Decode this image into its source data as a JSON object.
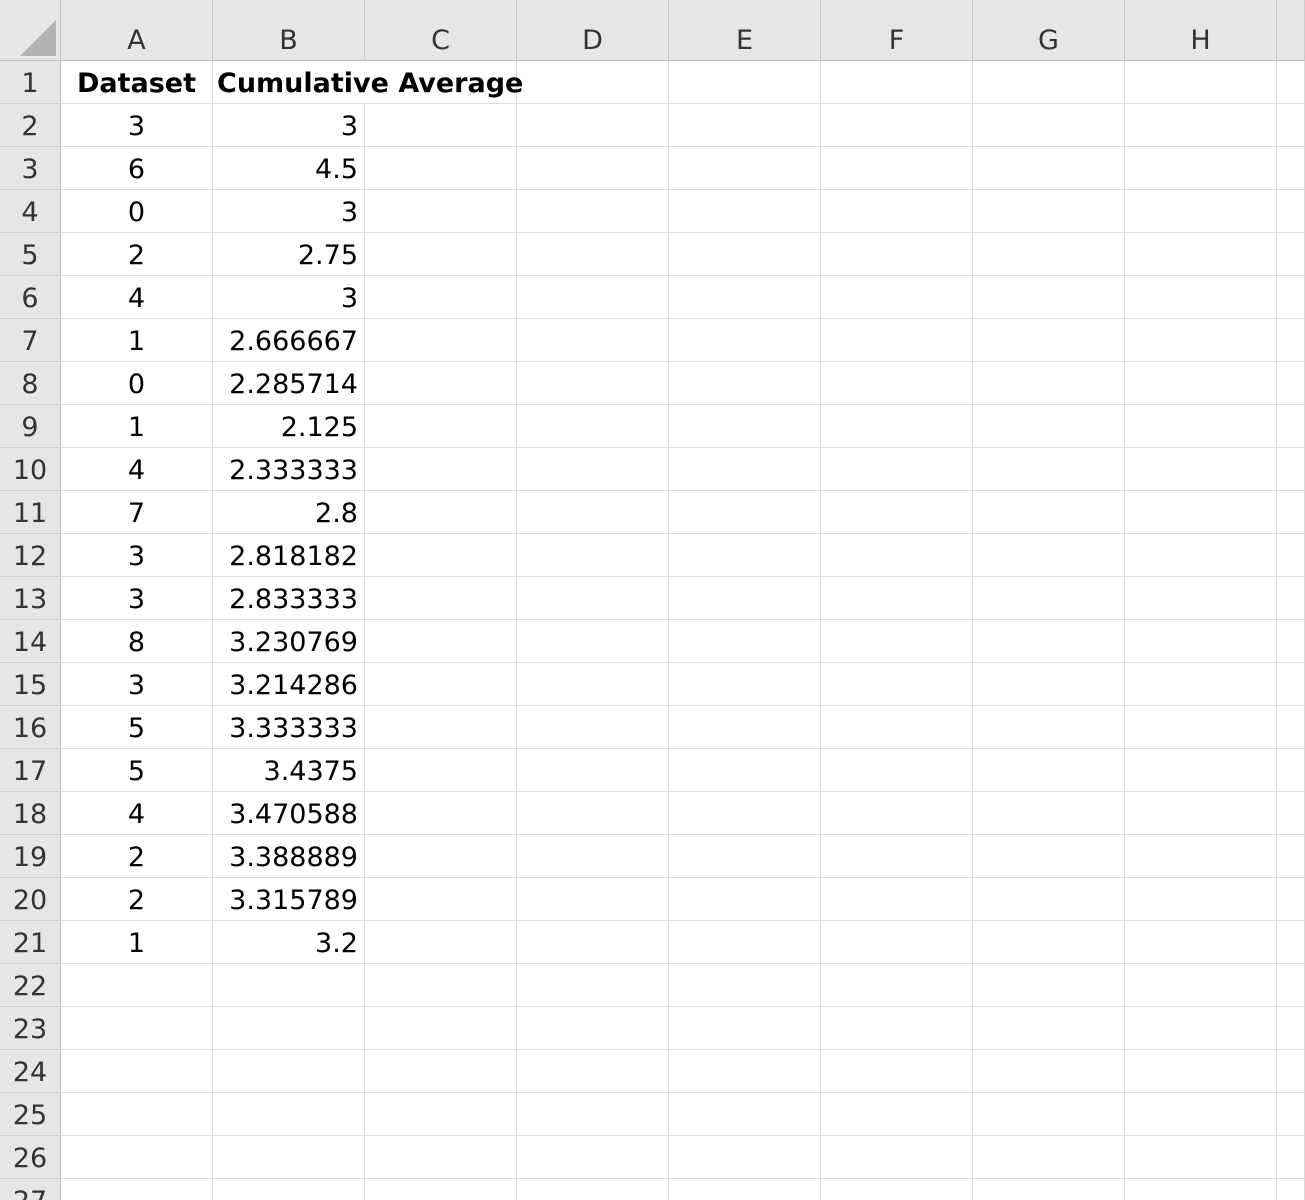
{
  "columns": [
    "A",
    "B",
    "C",
    "D",
    "E",
    "F",
    "G",
    "H"
  ],
  "rows": [
    "1",
    "2",
    "3",
    "4",
    "5",
    "6",
    "7",
    "8",
    "9",
    "10",
    "11",
    "12",
    "13",
    "14",
    "15",
    "16",
    "17",
    "18",
    "19",
    "20",
    "21",
    "22",
    "23",
    "24",
    "25",
    "26",
    "27"
  ],
  "header": {
    "dataset": "Dataset",
    "cumulative_average": "Cumulative Average"
  },
  "table": [
    {
      "dataset": "3",
      "cumulative_average": "3"
    },
    {
      "dataset": "6",
      "cumulative_average": "4.5"
    },
    {
      "dataset": "0",
      "cumulative_average": "3"
    },
    {
      "dataset": "2",
      "cumulative_average": "2.75"
    },
    {
      "dataset": "4",
      "cumulative_average": "3"
    },
    {
      "dataset": "1",
      "cumulative_average": "2.666667"
    },
    {
      "dataset": "0",
      "cumulative_average": "2.285714"
    },
    {
      "dataset": "1",
      "cumulative_average": "2.125"
    },
    {
      "dataset": "4",
      "cumulative_average": "2.333333"
    },
    {
      "dataset": "7",
      "cumulative_average": "2.8"
    },
    {
      "dataset": "3",
      "cumulative_average": "2.818182"
    },
    {
      "dataset": "3",
      "cumulative_average": "2.833333"
    },
    {
      "dataset": "8",
      "cumulative_average": "3.230769"
    },
    {
      "dataset": "3",
      "cumulative_average": "3.214286"
    },
    {
      "dataset": "5",
      "cumulative_average": "3.333333"
    },
    {
      "dataset": "5",
      "cumulative_average": "3.4375"
    },
    {
      "dataset": "4",
      "cumulative_average": "3.470588"
    },
    {
      "dataset": "2",
      "cumulative_average": "3.388889"
    },
    {
      "dataset": "2",
      "cumulative_average": "3.315789"
    },
    {
      "dataset": "1",
      "cumulative_average": "3.2"
    }
  ],
  "colors": {
    "header_bg": "#e6e6e6",
    "gridline": "#dcdcdc",
    "header_text": "#333333"
  }
}
